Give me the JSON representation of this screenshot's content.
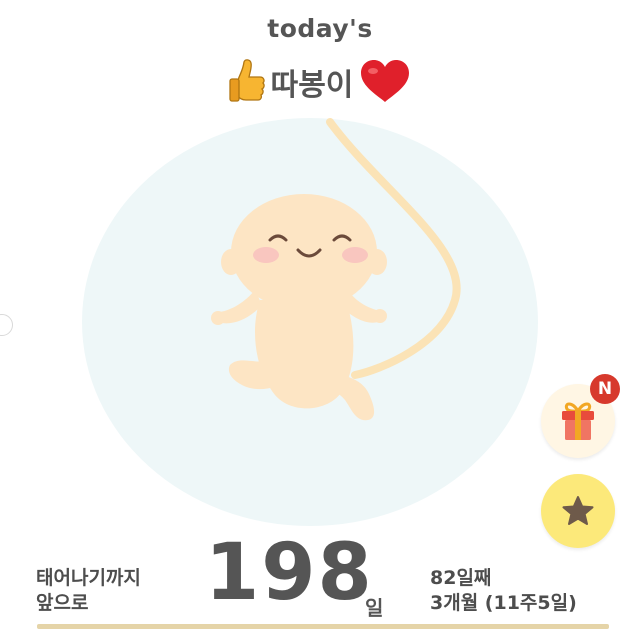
{
  "header": {
    "subtitle": "today's",
    "name": "따봉이",
    "thumbs_icon": "thumbs-up-icon",
    "heart_icon": "red-heart-icon"
  },
  "illustration": {
    "subject": "baby-in-womb",
    "womb_color": "#eef7f8",
    "skin_color": "#fde5c4"
  },
  "floating_buttons": {
    "gift": {
      "icon": "gift-icon",
      "badge": "N"
    },
    "favorite": {
      "icon": "star-icon"
    }
  },
  "countdown": {
    "label_line1": "태어나기까지",
    "label_line2": "앞으로",
    "days": "198",
    "unit": "일"
  },
  "pregnancy": {
    "day_text": "82일째",
    "month_week_text": "3개월 (11주5일)"
  },
  "colors": {
    "accent_underline": "#e5d4a8",
    "badge": "#d7392c",
    "star_button": "#fce97a",
    "gift_button": "#fff6e4"
  }
}
